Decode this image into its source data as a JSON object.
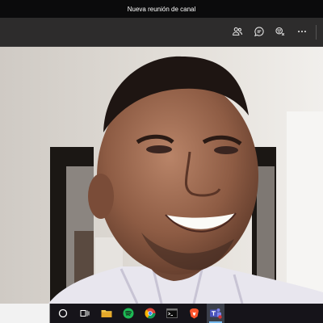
{
  "window": {
    "title": "Nueva reunión de canal"
  },
  "toolbar": {
    "buttons": [
      {
        "name": "participants",
        "icon": "people-icon"
      },
      {
        "name": "chat",
        "icon": "chat-bubble-icon"
      },
      {
        "name": "reactions",
        "icon": "emoji-icon"
      },
      {
        "name": "more",
        "icon": "ellipsis-icon"
      }
    ]
  },
  "taskbar": {
    "search": {
      "placeholder": ""
    },
    "apps": [
      {
        "name": "cortana",
        "icon": "circle-icon"
      },
      {
        "name": "task-view",
        "icon": "task-view-icon"
      },
      {
        "name": "file-explorer",
        "icon": "folder-icon"
      },
      {
        "name": "spotify",
        "icon": "spotify-icon"
      },
      {
        "name": "chrome",
        "icon": "chrome-icon"
      },
      {
        "name": "terminal",
        "icon": "terminal-icon"
      },
      {
        "name": "brave",
        "icon": "brave-icon"
      },
      {
        "name": "teams",
        "icon": "teams-icon",
        "active": true
      }
    ]
  },
  "colors": {
    "titlebar": "#0b0b0c",
    "toolbar": "#2d2c2c",
    "taskbar": "#16141a",
    "accent": "#76b9ed"
  }
}
